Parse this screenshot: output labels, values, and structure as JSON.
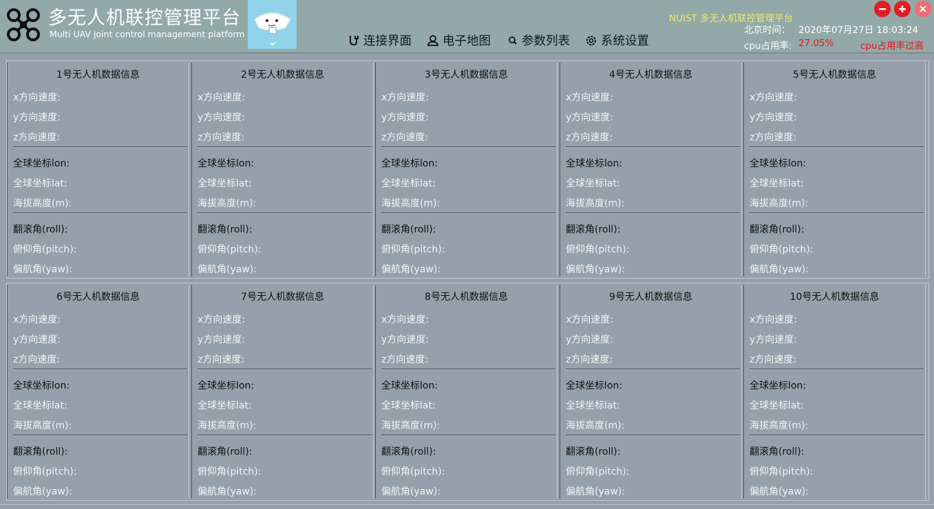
{
  "header": {
    "title_cn": "多无人机联控管理平台",
    "title_en": "Multi UAV joint control management platform",
    "logo_icon": "drone-icon",
    "brand_right": "NUIST 多无人机联控管理平台",
    "time_label": "北京时间：",
    "time_value": "2020年07月27日 18:03:24",
    "cpu_label": "cpu占用率:",
    "cpu_value": "27.05%",
    "cpu_warning": "cpu占用率过高"
  },
  "nav": [
    {
      "label": "连接界面",
      "icon": "plug-icon"
    },
    {
      "label": "电子地图",
      "icon": "user-icon"
    },
    {
      "label": "参数列表",
      "icon": "search-icon"
    },
    {
      "label": "系统设置",
      "icon": "gear-icon"
    }
  ],
  "window_buttons": [
    "minimize-icon",
    "maximize-icon",
    "close-icon"
  ],
  "colors": {
    "header_bg": "#92a9a7",
    "body_bg": "#96a0aa",
    "brand_yellow": "#f2e86a",
    "alert_red": "#e8141c"
  },
  "fields": {
    "vx": "x方向速度:",
    "vy": "y方向速度:",
    "vz": "z方向速度:",
    "lon": "全球坐标lon:",
    "lat": "全球坐标lat:",
    "alt": "海拔高度(m):",
    "roll": "翻滚角(roll):",
    "pitch": "俯仰角(pitch):",
    "yaw": "偏航角(yaw):"
  },
  "panels": [
    {
      "title": "1号无人机数据信息"
    },
    {
      "title": "2号无人机数据信息"
    },
    {
      "title": "3号无人机数据信息"
    },
    {
      "title": "4号无人机数据信息"
    },
    {
      "title": "5号无人机数据信息"
    },
    {
      "title": "6号无人机数据信息"
    },
    {
      "title": "7号无人机数据信息"
    },
    {
      "title": "8号无人机数据信息"
    },
    {
      "title": "9号无人机数据信息"
    },
    {
      "title": "10号无人机数据信息"
    }
  ]
}
